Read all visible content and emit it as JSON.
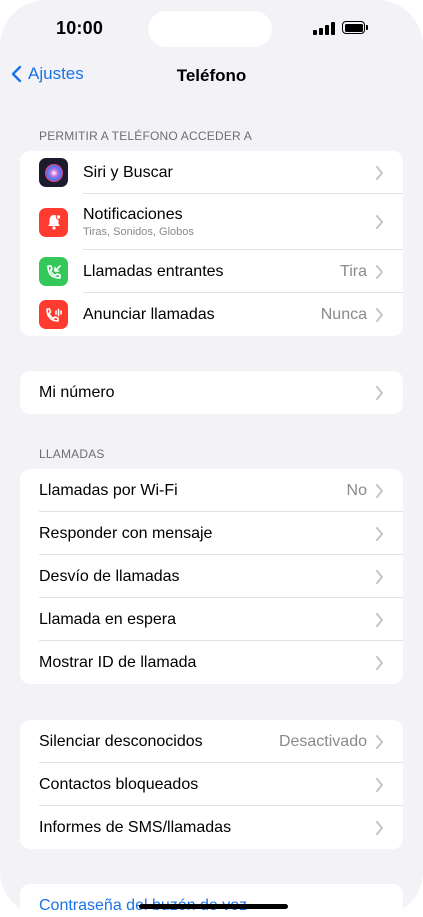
{
  "status": {
    "time": "10:00"
  },
  "nav": {
    "back_label": "Ajustes",
    "title": "Teléfono"
  },
  "section_access": {
    "header": "PERMITIR A TELÉFONO ACCEDER A",
    "items": [
      {
        "label": "Siri y Buscar",
        "icon": "siri-icon"
      },
      {
        "label": "Notificaciones",
        "sublabel": "Tiras, Sonidos, Globos",
        "icon": "notifications-icon",
        "color": "#ff3b30"
      },
      {
        "label": "Llamadas entrantes",
        "value": "Tira",
        "icon": "incoming-call-icon",
        "color": "#34c759"
      },
      {
        "label": "Anunciar llamadas",
        "value": "Nunca",
        "icon": "announce-calls-icon",
        "color": "#ff3b30"
      }
    ]
  },
  "section_number": {
    "items": [
      {
        "label": "Mi número"
      }
    ]
  },
  "section_calls": {
    "header": "LLAMADAS",
    "items": [
      {
        "label": "Llamadas por Wi-Fi",
        "value": "No"
      },
      {
        "label": "Responder con mensaje"
      },
      {
        "label": "Desvío de llamadas"
      },
      {
        "label": "Llamada en espera"
      },
      {
        "label": "Mostrar ID de llamada"
      }
    ]
  },
  "section_block": {
    "items": [
      {
        "label": "Silenciar desconocidos",
        "value": "Desactivado"
      },
      {
        "label": "Contactos bloqueados"
      },
      {
        "label": "Informes de SMS/llamadas"
      }
    ]
  },
  "voicemail": {
    "label": "Contraseña del buzón de voz"
  },
  "colors": {
    "accent": "#1a73e8",
    "background": "#f2f2f7"
  }
}
